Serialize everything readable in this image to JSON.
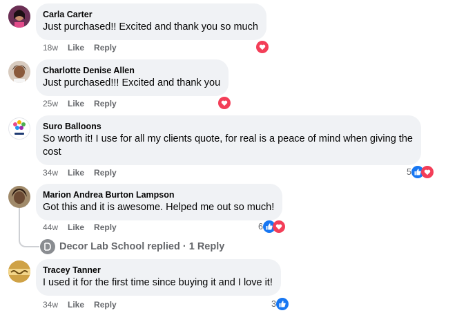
{
  "colors": {
    "bubble": "#f0f2f5",
    "meta": "#65676b",
    "like_blue": "#1877f2",
    "love_red": "#f33e58"
  },
  "comments": [
    {
      "author": "Carla Carter",
      "text": "Just purchased!! Excited and thank you so much",
      "time": "18w",
      "like_label": "Like",
      "reply_label": "Reply",
      "reactions": [
        "heart-icon"
      ],
      "reaction_count": ""
    },
    {
      "author": "Charlotte Denise Allen",
      "text": "Just purchased!!! Excited and thank you",
      "time": "25w",
      "like_label": "Like",
      "reply_label": "Reply",
      "reactions": [
        "heart-icon"
      ],
      "reaction_count": ""
    },
    {
      "author": "Suro Balloons",
      "text_line1": "So worth it! I use for all my clients quote, for real is a peace of mind when giving the",
      "text_line2": "cost",
      "time": "34w",
      "like_label": "Like",
      "reply_label": "Reply",
      "reactions": [
        "thumbs-up-icon",
        "heart-icon"
      ],
      "reaction_count": "5"
    },
    {
      "author": "Marion Andrea Burton Lampson",
      "text": "Got this and it is awesome. Helped me out so much!",
      "time": "44w",
      "like_label": "Like",
      "reply_label": "Reply",
      "reactions": [
        "thumbs-up-icon",
        "heart-icon"
      ],
      "reaction_count": "6"
    },
    {
      "author": "Tracey Tanner",
      "text": "I used it for the first time since buying it and I love it!",
      "time": "34w",
      "like_label": "Like",
      "reply_label": "Reply",
      "reactions": [
        "thumbs-up-icon"
      ],
      "reaction_count": "3"
    }
  ],
  "replies_link": {
    "text": "Decor Lab School replied · 1 Reply"
  }
}
